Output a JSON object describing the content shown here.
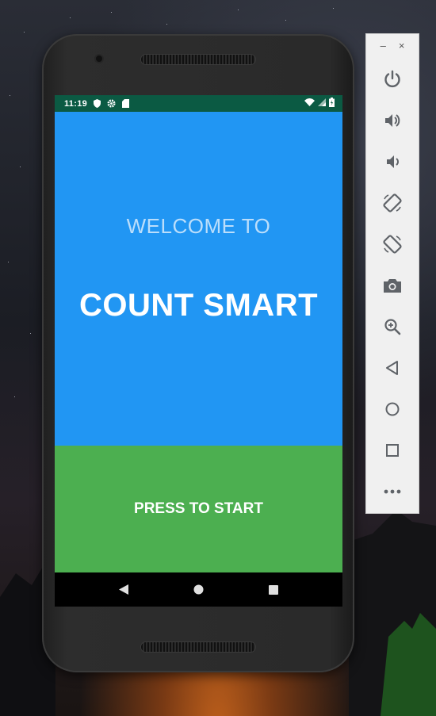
{
  "status_bar": {
    "time": "11:19"
  },
  "app": {
    "welcome_label": "WELCOME TO",
    "title": "COUNT SMART",
    "start_button_label": "PRESS TO START"
  },
  "colors": {
    "status_bar": "#0b5a43",
    "welcome_background": "#2196f3",
    "start_background": "#4caf50",
    "nav_bar": "#000000"
  },
  "android_nav": [
    "back-icon",
    "home-icon",
    "recents-icon"
  ],
  "emulator_toolbar": {
    "window_controls": [
      "minimize-icon",
      "close-icon"
    ],
    "minimize_glyph": "–",
    "close_glyph": "×",
    "buttons": [
      "power-icon",
      "volume-up-icon",
      "volume-down-icon",
      "rotate-left-icon",
      "rotate-right-icon",
      "camera-icon",
      "zoom-icon",
      "back-icon",
      "home-icon",
      "overview-icon",
      "more-icon"
    ]
  }
}
